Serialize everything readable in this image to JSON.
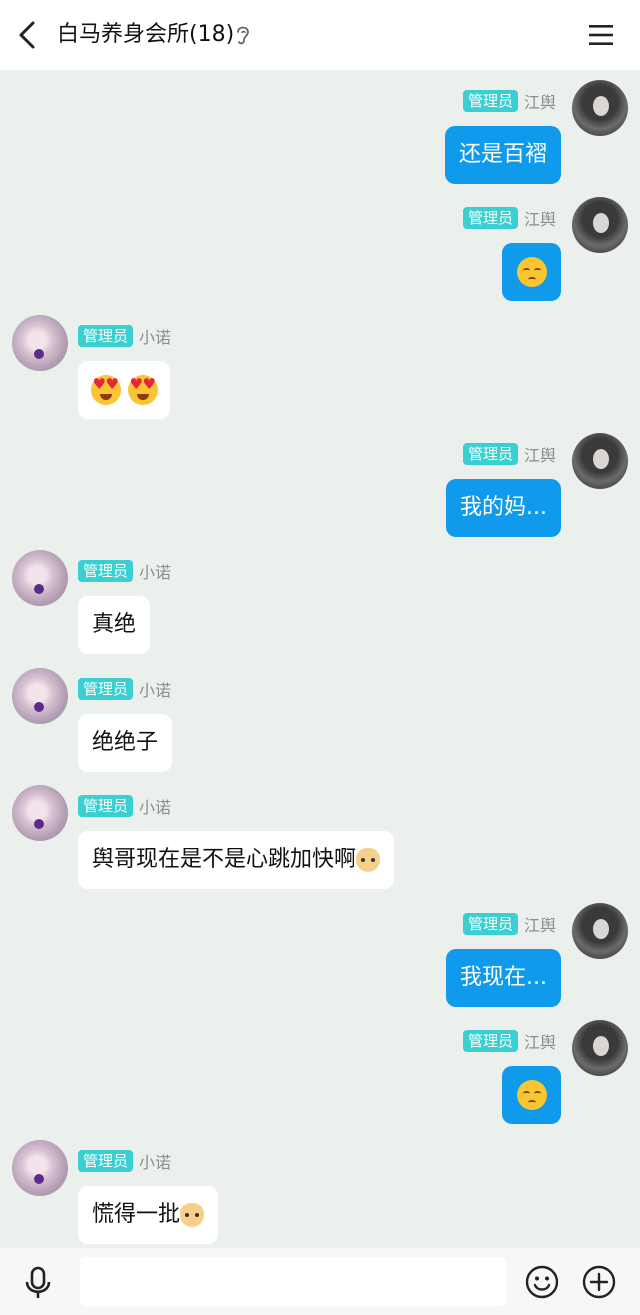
{
  "header": {
    "title": "白马养身会所(18)",
    "icons": {
      "back": "back-arrow-icon",
      "ear": "ear-icon",
      "menu": "menu-icon"
    }
  },
  "badge_label": "管理员",
  "messages": [
    {
      "side": "right",
      "nick": "江舆",
      "text": "还是百褶"
    },
    {
      "side": "right",
      "nick": "江舆",
      "emoji": "pensive-face"
    },
    {
      "side": "left",
      "nick": "小诺",
      "emoji": "heart-eyes-x2"
    },
    {
      "side": "right",
      "nick": "江舆",
      "text": "我的妈..."
    },
    {
      "side": "left",
      "nick": "小诺",
      "text": "真绝"
    },
    {
      "side": "left",
      "nick": "小诺",
      "text": "绝绝子"
    },
    {
      "side": "left",
      "nick": "小诺",
      "text": "舆哥现在是不是心跳加快啊",
      "trailing_emoji": "doge"
    },
    {
      "side": "right",
      "nick": "江舆",
      "text": "我现在..."
    },
    {
      "side": "right",
      "nick": "江舆",
      "emoji": "pensive-face"
    },
    {
      "side": "left",
      "nick": "小诺",
      "text": "慌得一批",
      "trailing_emoji": "doge"
    }
  ],
  "bottom_bar": {
    "input_value": "",
    "icons": {
      "voice": "microphone-icon",
      "emoji": "smiley-icon",
      "more": "plus-icon"
    }
  }
}
